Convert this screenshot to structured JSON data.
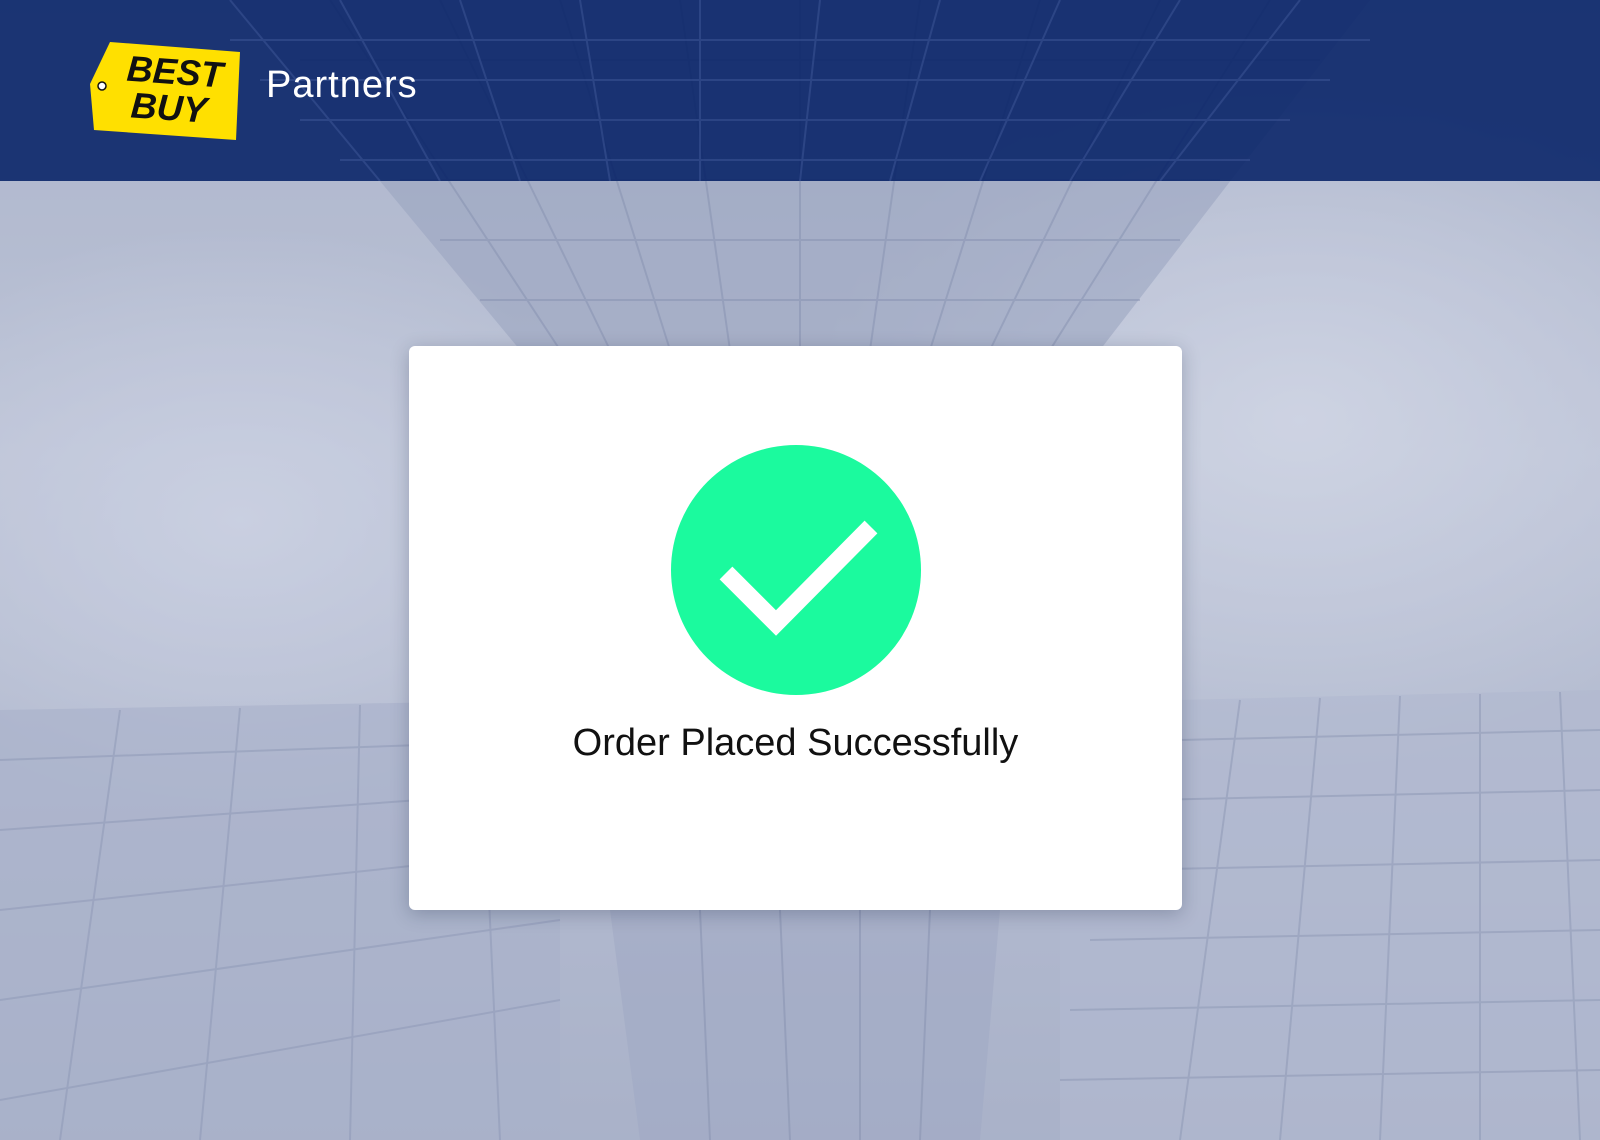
{
  "header": {
    "logo": {
      "line1": "BEST",
      "line2": "BUY",
      "color": "#FFE000"
    },
    "title": "Partners",
    "background_color": "#021E64"
  },
  "modal": {
    "icon": "checkmark-circle-icon",
    "icon_color": "#1BFA9E",
    "message": "Order Placed Successfully"
  }
}
